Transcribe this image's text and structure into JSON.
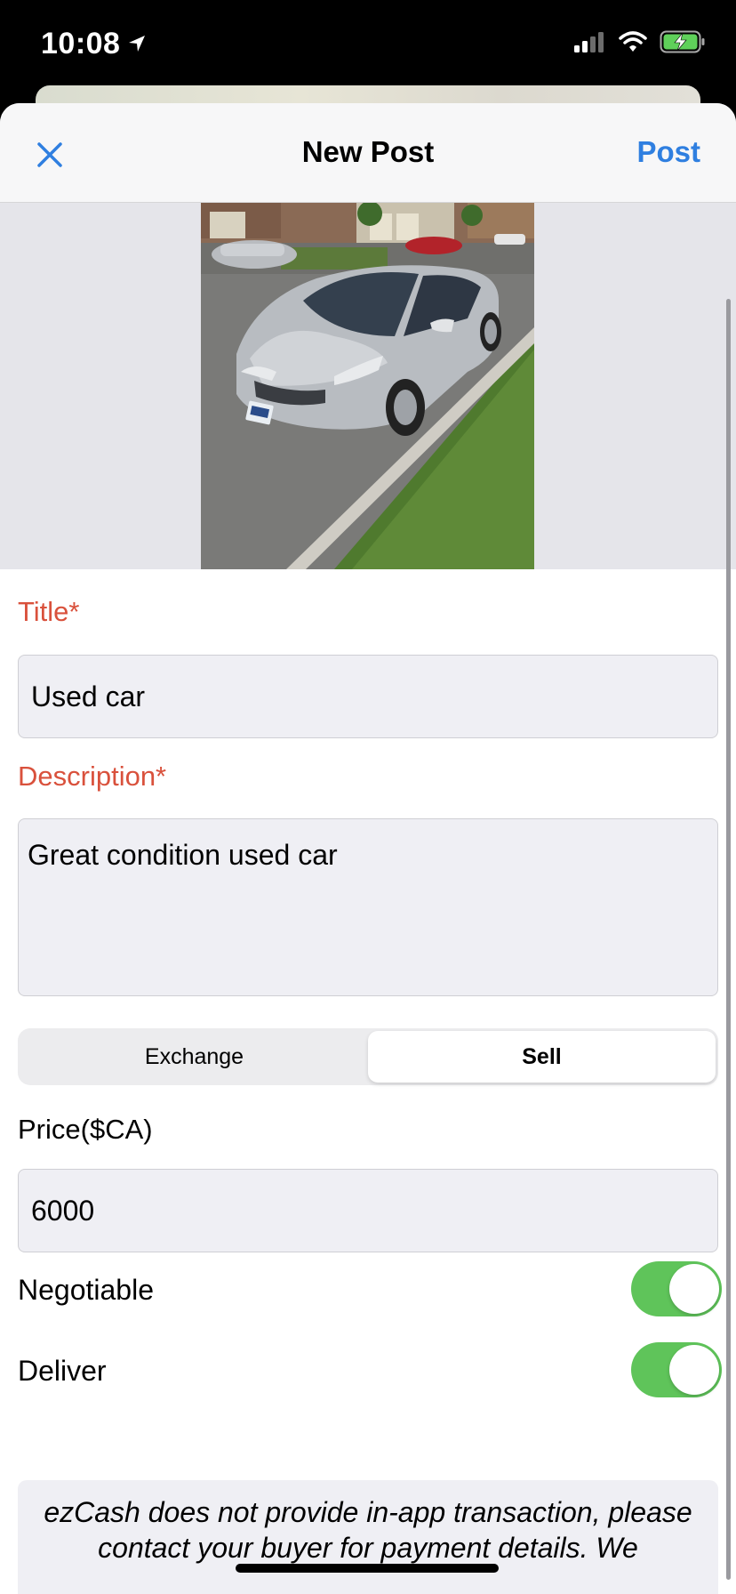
{
  "status_bar": {
    "time": "10:08",
    "icons": [
      "location-arrow-icon",
      "cellular-signal-icon",
      "wifi-icon",
      "battery-charging-icon"
    ]
  },
  "nav": {
    "title": "New Post",
    "post_label": "Post",
    "close_icon": "close-icon"
  },
  "photo": {
    "subject": "silver sedan parked on street"
  },
  "form": {
    "title_label": "Title*",
    "title_value": "Used car",
    "description_label": "Description*",
    "description_value": "Great condition used car",
    "mode_options": [
      "Exchange",
      "Sell"
    ],
    "mode_selected": "Sell",
    "price_label": "Price($CA)",
    "price_value": "6000",
    "negotiable_label": "Negotiable",
    "negotiable_on": true,
    "deliver_label": "Deliver",
    "deliver_on": true
  },
  "notice": {
    "text": "ezCash does not provide in-app transaction, please contact your buyer for payment details. We"
  },
  "colors": {
    "accent": "#2f7fe0",
    "required": "#d9513c",
    "toggle_on": "#5fc45a"
  }
}
